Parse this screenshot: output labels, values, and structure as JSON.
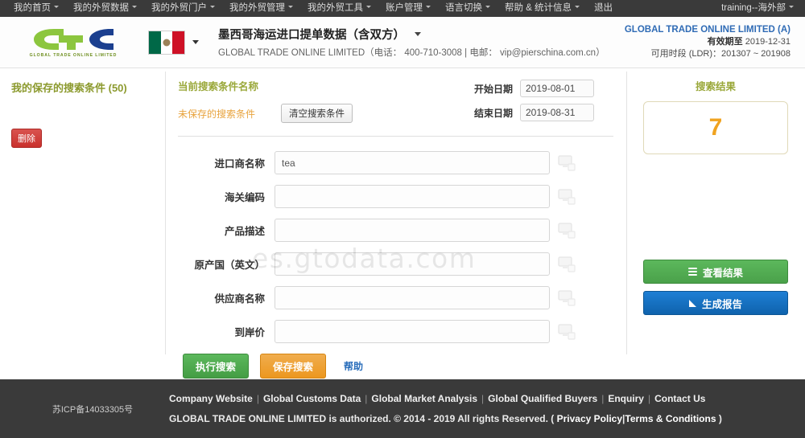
{
  "topnav": {
    "items": [
      {
        "label": "我的首页",
        "caret": true
      },
      {
        "label": "我的外贸数据",
        "caret": true
      },
      {
        "label": "我的外贸门户",
        "caret": true
      },
      {
        "label": "我的外贸管理",
        "caret": true
      },
      {
        "label": "我的外贸工具",
        "caret": true
      },
      {
        "label": "账户管理",
        "caret": true
      },
      {
        "label": "语言切换",
        "caret": true
      },
      {
        "label": "帮助 & 统计信息",
        "caret": true
      },
      {
        "label": "退出",
        "caret": false
      }
    ],
    "user": "training--海外部"
  },
  "header": {
    "logo_text": "GTO",
    "logo_subtitle": "GLOBAL TRADE ONLINE LIMITED",
    "flag_country": "mexico",
    "title": "墨西哥海运进口提单数据（含双方）",
    "subtitle": "GLOBAL TRADE ONLINE LIMITED（电话： 400-710-3008 | 电邮： vip@pierschina.com.cn）",
    "account_name": "GLOBAL TRADE ONLINE LIMITED (A)",
    "validity_label": "有效期至",
    "validity_value": "2019-12-31",
    "ldr_line": "可用时段 (LDR)：201307 ~ 201908"
  },
  "sidebar": {
    "saved_title": "我的保存的搜索条件 (50)",
    "delete_label": "删除"
  },
  "search_form": {
    "criteria_name_label": "当前搜索条件名称",
    "unsaved_label": "未保存的搜索条件",
    "clear_button": "清空搜索条件",
    "start_date_label": "开始日期",
    "start_date_value": "2019-08-01",
    "end_date_label": "结束日期",
    "end_date_value": "2019-08-31",
    "fields": [
      {
        "label": "进口商名称",
        "value": "tea",
        "icon": "screen-icon"
      },
      {
        "label": "海关编码",
        "value": "",
        "icon": "screen-icon"
      },
      {
        "label": "产品描述",
        "value": "",
        "icon": "screen-icon"
      },
      {
        "label": "原产国（英文）",
        "value": "",
        "icon": "screen-icon"
      },
      {
        "label": "供应商名称",
        "value": "",
        "icon": "screen-icon"
      },
      {
        "label": "到岸价",
        "value": "",
        "icon": "screen-icon"
      }
    ],
    "execute_button": "执行搜索",
    "save_button": "保存搜索",
    "help_link": "帮助",
    "watermark": "es.gtodata.com"
  },
  "results": {
    "title": "搜索结果",
    "count": "7",
    "view_button": "查看结果",
    "report_button": "生成报告"
  },
  "footer": {
    "icp": "苏ICP备14033305号",
    "links": [
      "Company Website",
      "Global Customs Data",
      "Global Market Analysis",
      "Global Qualified Buyers",
      "Enquiry",
      "Contact Us"
    ],
    "copyright_pre": "GLOBAL TRADE ONLINE LIMITED is authorized. © 2014 - 2019 All rights Reserved.  (",
    "privacy": "Privacy Policy",
    "terms": "Terms & Conditions",
    "copyright_post": ")"
  },
  "colors": {
    "nav_bg": "#3a3a3a",
    "accent_green": "#5cb85c",
    "accent_blue": "#1e7fd4",
    "accent_orange": "#f0ad4e",
    "result_number": "#f0a320",
    "olive": "#9aa83a",
    "link_blue": "#2f6bb5",
    "danger_red": "#c9302c"
  }
}
